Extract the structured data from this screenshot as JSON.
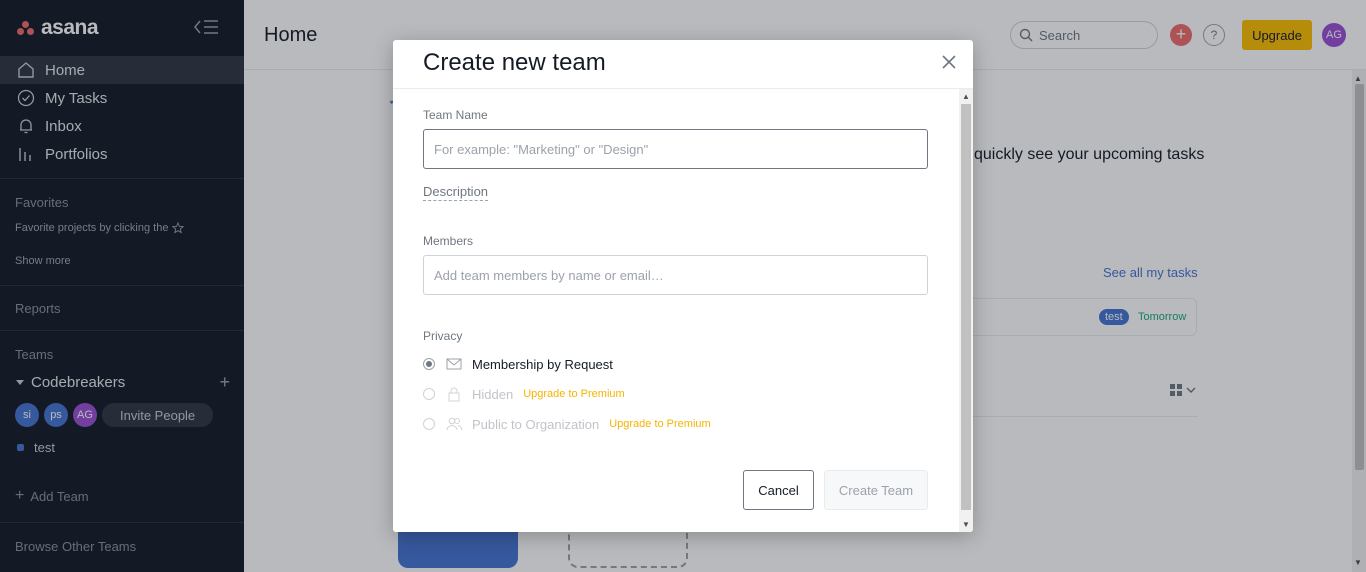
{
  "app": {
    "logo_text": "asana"
  },
  "sidebar": {
    "nav": [
      {
        "label": "Home",
        "icon": "home-icon"
      },
      {
        "label": "My Tasks",
        "icon": "check-circle-icon"
      },
      {
        "label": "Inbox",
        "icon": "bell-icon"
      },
      {
        "label": "Portfolios",
        "icon": "bar-chart-icon"
      }
    ],
    "favorites_title": "Favorites",
    "favorites_hint": "Favorite projects by clicking the",
    "show_more": "Show more",
    "reports": "Reports",
    "teams_title": "Teams",
    "team_name": "Codebreakers",
    "members": [
      {
        "initials": "si",
        "color": "#4573d2"
      },
      {
        "initials": "ps",
        "color": "#4573d2"
      },
      {
        "initials": "AG",
        "color": "#9b4ed6"
      }
    ],
    "invite_label": "Invite People",
    "project_name": "test",
    "add_team": "Add Team",
    "browse_teams": "Browse Other Teams"
  },
  "header": {
    "title": "Home",
    "search_placeholder": "Search",
    "help": "?",
    "upgrade_label": "Upgrade",
    "user_initials": "AG"
  },
  "background": {
    "upcoming_text": "quickly see your upcoming tasks",
    "see_all": "See all my tasks",
    "task_tag": "test",
    "task_due": "Tomorrow"
  },
  "modal": {
    "title": "Create new team",
    "team_name_label": "Team Name",
    "team_name_placeholder": "For example: \"Marketing\" or \"Design\"",
    "team_name_value": "",
    "description_link": "Description",
    "members_label": "Members",
    "members_placeholder": "Add team members by name or email…",
    "privacy_label": "Privacy",
    "privacy_options": [
      {
        "label": "Membership by Request",
        "icon": "envelope-icon",
        "selected": true,
        "disabled": false,
        "badge": ""
      },
      {
        "label": "Hidden",
        "icon": "lock-icon",
        "selected": false,
        "disabled": true,
        "badge": "Upgrade to Premium"
      },
      {
        "label": "Public to Organization",
        "icon": "people-icon",
        "selected": false,
        "disabled": true,
        "badge": "Upgrade to Premium"
      }
    ],
    "cancel_label": "Cancel",
    "create_label": "Create Team"
  },
  "colors": {
    "sidebar_bg": "#151b26",
    "accent_coral": "#f06a6a",
    "upgrade_yellow": "#fcbd01",
    "link_blue": "#4573d2",
    "premium_gold": "#f5b301"
  }
}
